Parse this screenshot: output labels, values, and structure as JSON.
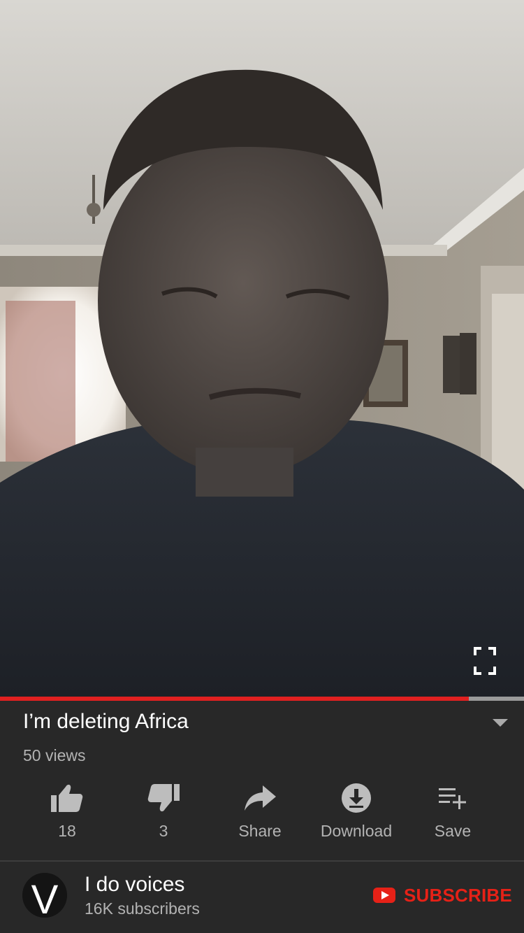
{
  "video": {
    "progress_fraction": 0.895
  },
  "info": {
    "title": "I’m deleting Africa",
    "views": "50 views"
  },
  "actions": [
    {
      "icon": "thumbs-up-icon",
      "label": "18"
    },
    {
      "icon": "thumbs-down-icon",
      "label": "3"
    },
    {
      "icon": "share-icon",
      "label": "Share"
    },
    {
      "icon": "download-icon",
      "label": "Download"
    },
    {
      "icon": "playlist-add-icon",
      "label": "Save"
    }
  ],
  "channel": {
    "name": "I do voices",
    "subscribers": "16K subscribers",
    "avatar_letter": "V",
    "subscribe_label": "SUBSCRIBE"
  },
  "colors": {
    "background": "#282828",
    "progress_played": "#e02020",
    "subscribe_red": "#e62117",
    "text_primary": "#ffffff",
    "text_secondary": "#b3b3b3"
  }
}
